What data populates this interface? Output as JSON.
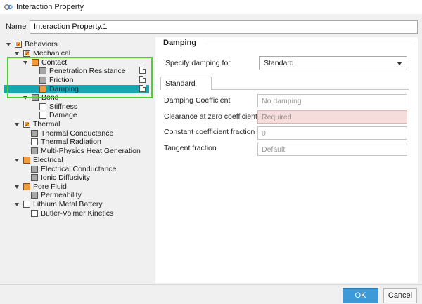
{
  "window": {
    "title": "Interaction Property",
    "icon": "interaction-property-icon"
  },
  "name": {
    "label": "Name",
    "value": "Interaction Property.1"
  },
  "tree": {
    "behaviors": "Behaviors",
    "mechanical": "Mechanical",
    "contact": "Contact",
    "penetration_resistance": "Penetration Resistance",
    "friction": "Friction",
    "damping": "Damping",
    "bond": "Bond",
    "stiffness": "Stiffness",
    "damage": "Damage",
    "thermal": "Thermal",
    "thermal_conductance": "Thermal Conductance",
    "thermal_radiation": "Thermal Radiation",
    "multiphysics_heat": "Multi-Physics Heat Generation",
    "electrical": "Electrical",
    "electrical_conductance": "Electrical Conductance",
    "ionic_diffusivity": "Ionic Diffusivity",
    "pore_fluid": "Pore Fluid",
    "permeability": "Permeability",
    "lithium_metal_battery": "Lithium Metal Battery",
    "butler_volmer": "Butler-Volmer Kinetics"
  },
  "panel": {
    "section_title": "Damping",
    "specify_label": "Specify damping for",
    "specify_value": "Standard",
    "tab": "Standard",
    "fields": {
      "damping_coefficient": {
        "label": "Damping Coefficient",
        "placeholder": "No damping"
      },
      "clearance": {
        "label": "Clearance at zero coefficient",
        "placeholder": "Required"
      },
      "constant_fraction": {
        "label": "Constant coefficient fraction",
        "placeholder": "0"
      },
      "tangent_fraction": {
        "label": "Tangent fraction",
        "placeholder": "Default"
      }
    }
  },
  "buttons": {
    "ok": "OK",
    "cancel": "Cancel"
  },
  "colors": {
    "selection": "#1aa6b0",
    "highlight_frame": "#4ad12a",
    "ok_button": "#3c9ad8",
    "required_field": "#f5dddb"
  }
}
